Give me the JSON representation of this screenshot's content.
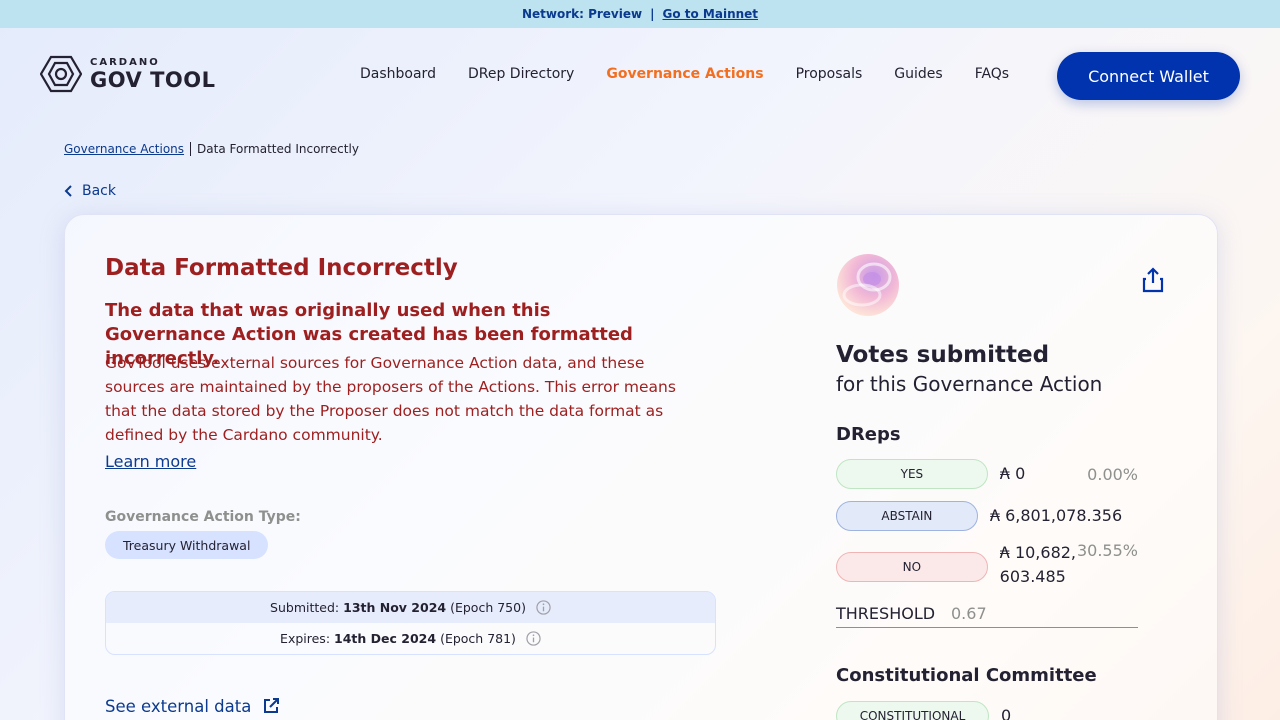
{
  "banner": {
    "network_text": "Network: Preview",
    "separator": "|",
    "mainnet_link": "Go to Mainnet"
  },
  "logo": {
    "small": "CARDANO",
    "big": "GOV TOOL",
    "icon": "cardano-gov-logo-icon"
  },
  "nav": {
    "items": [
      "Dashboard",
      "DRep Directory",
      "Governance Actions",
      "Proposals",
      "Guides",
      "FAQs"
    ],
    "active": "Governance Actions",
    "connect_label": "Connect Wallet"
  },
  "breadcrumb": {
    "parent": "Governance Actions",
    "current": "Data Formatted Incorrectly"
  },
  "back_label": "Back",
  "error": {
    "title": "Data Formatted Incorrectly",
    "subtitle": "The data that was originally used when this Governance Action was created has been formatted incorrectly.",
    "body": "GovTool uses external sources for Governance Action data, and these sources are maintained by the proposers of the Actions. This error means that the data stored by the Proposer does not match the data format as defined by the Cardano community.",
    "learn_more": "Learn more"
  },
  "action_type": {
    "label": "Governance Action Type:",
    "value": "Treasury Withdrawal"
  },
  "dates": {
    "submitted_label": "Submitted:",
    "submitted_date": "13th Nov 2024",
    "submitted_epoch": "(Epoch 750)",
    "expires_label": "Expires:",
    "expires_date": "14th Dec 2024",
    "expires_epoch": "(Epoch 781)"
  },
  "external_link": "See external data",
  "votes": {
    "title": "Votes submitted",
    "subtitle": "for this Governance Action",
    "dreps_heading": "DReps",
    "rows": [
      {
        "label": "YES",
        "amount": "₳ 0",
        "percent": "0.00%"
      },
      {
        "label": "ABSTAIN",
        "amount": "₳ 6,801,078.356",
        "percent": ""
      },
      {
        "label": "NO",
        "amount": "₳ 10,682,603.485",
        "percent": "30.55%"
      }
    ],
    "threshold_label": "THRESHOLD",
    "threshold_value": "0.67",
    "cc_heading": "Constitutional Committee",
    "cc_row": {
      "label": "CONSTITUTIONAL",
      "amount": "0"
    }
  },
  "colors": {
    "accent": "#0033ad",
    "active_nav": "#f36e1f",
    "error": "#9d1f1f"
  }
}
